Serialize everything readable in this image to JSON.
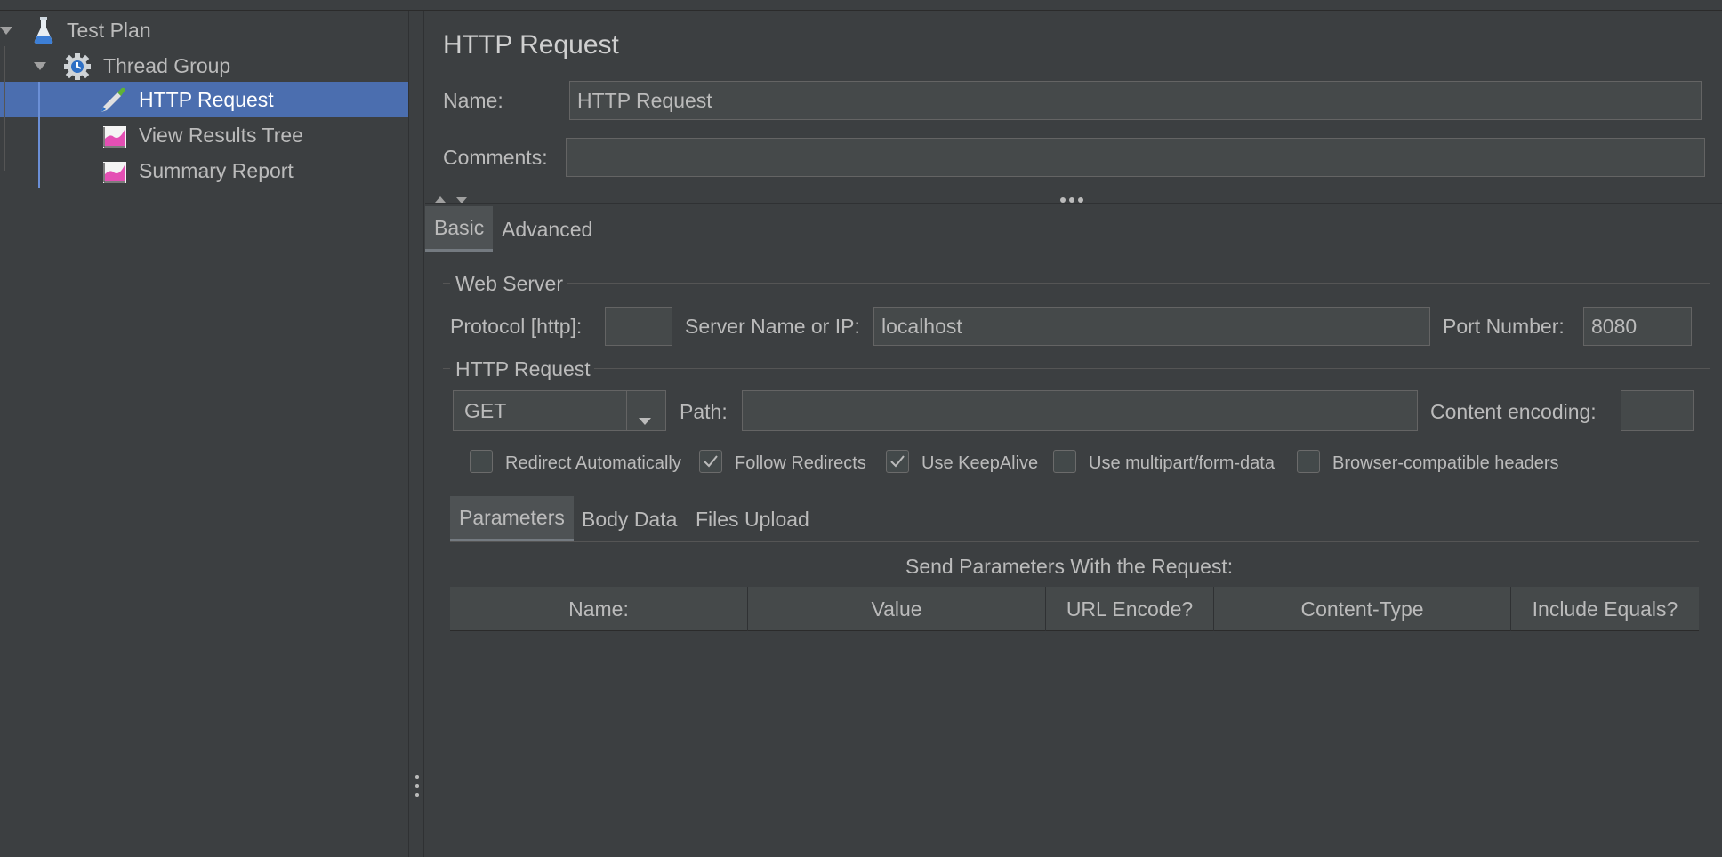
{
  "tree": {
    "items": [
      {
        "label": "Test Plan",
        "icon": "flask-icon"
      },
      {
        "label": "Thread Group",
        "icon": "gear-icon"
      },
      {
        "label": "HTTP Request",
        "icon": "pipette-icon"
      },
      {
        "label": "View Results Tree",
        "icon": "graph-icon"
      },
      {
        "label": "Summary Report",
        "icon": "graph-icon"
      }
    ]
  },
  "panel": {
    "title": "HTTP Request",
    "name_label": "Name:",
    "name_value": "HTTP Request",
    "comments_label": "Comments:",
    "comments_value": "",
    "tabs": [
      "Basic",
      "Advanced"
    ]
  },
  "web_server": {
    "legend": "Web Server",
    "protocol_label": "Protocol [http]:",
    "protocol_value": "",
    "server_label": "Server Name or IP:",
    "server_value": "localhost",
    "port_label": "Port Number:",
    "port_value": "8080"
  },
  "http_request": {
    "legend": "HTTP Request",
    "method": "GET",
    "path_label": "Path:",
    "path_value": "",
    "encoding_label": "Content encoding:",
    "encoding_value": ""
  },
  "options": [
    {
      "label": "Redirect Automatically",
      "checked": false
    },
    {
      "label": "Follow Redirects",
      "checked": true
    },
    {
      "label": "Use KeepAlive",
      "checked": true
    },
    {
      "label": "Use multipart/form-data",
      "checked": false
    },
    {
      "label": "Browser-compatible headers",
      "checked": false
    }
  ],
  "param_tabs": [
    "Parameters",
    "Body Data",
    "Files Upload"
  ],
  "params_caption": "Send Parameters With the Request:",
  "params_columns": [
    "Name:",
    "Value",
    "URL Encode?",
    "Content-Type",
    "Include Equals?"
  ],
  "colors": {
    "selection": "#4b6eaf",
    "background": "#3c3f41",
    "field": "#45494a"
  }
}
